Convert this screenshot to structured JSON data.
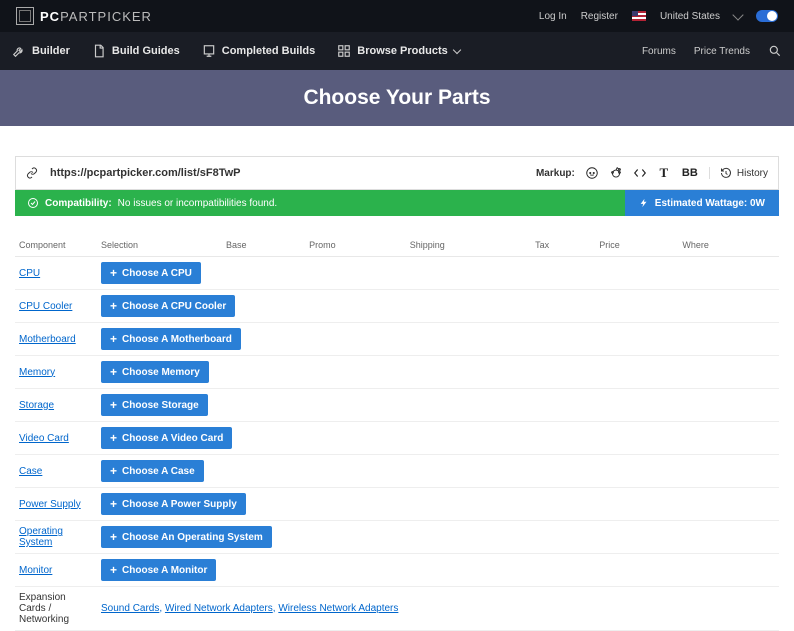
{
  "topbar": {
    "brand_prefix": "PC",
    "brand_main": "PARTPICKER",
    "login": "Log In",
    "register": "Register",
    "country": "United States"
  },
  "nav": {
    "builder": "Builder",
    "guides": "Build Guides",
    "completed": "Completed Builds",
    "browse": "Browse Products",
    "forums": "Forums",
    "trends": "Price Trends"
  },
  "hero": {
    "title": "Choose Your Parts"
  },
  "urlbar": {
    "url": "https://pcpartpicker.com/list/sF8TwP",
    "markup_label": "Markup:",
    "history": "History",
    "bb": "BB",
    "t": "T"
  },
  "status": {
    "compat_label": "Compatibility:",
    "compat_msg": "No issues or incompatibilities found.",
    "wattage": "Estimated Wattage: 0W"
  },
  "table": {
    "headers": {
      "component": "Component",
      "selection": "Selection",
      "base": "Base",
      "promo": "Promo",
      "shipping": "Shipping",
      "tax": "Tax",
      "price": "Price",
      "where": "Where"
    },
    "rows": [
      {
        "component": "CPU",
        "btn": "Choose A CPU"
      },
      {
        "component": "CPU Cooler",
        "btn": "Choose A CPU Cooler"
      },
      {
        "component": "Motherboard",
        "btn": "Choose A Motherboard"
      },
      {
        "component": "Memory",
        "btn": "Choose Memory"
      },
      {
        "component": "Storage",
        "btn": "Choose Storage"
      },
      {
        "component": "Video Card",
        "btn": "Choose A Video Card"
      },
      {
        "component": "Case",
        "btn": "Choose A Case"
      },
      {
        "component": "Power Supply",
        "btn": "Choose A Power Supply"
      },
      {
        "component": "Operating System",
        "btn": "Choose An Operating System"
      },
      {
        "component": "Monitor",
        "btn": "Choose A Monitor"
      }
    ],
    "expansion": {
      "label": "Expansion Cards / Networking",
      "links": [
        "Sound Cards",
        "Wired Network Adapters",
        "Wireless Network Adapters"
      ]
    }
  }
}
